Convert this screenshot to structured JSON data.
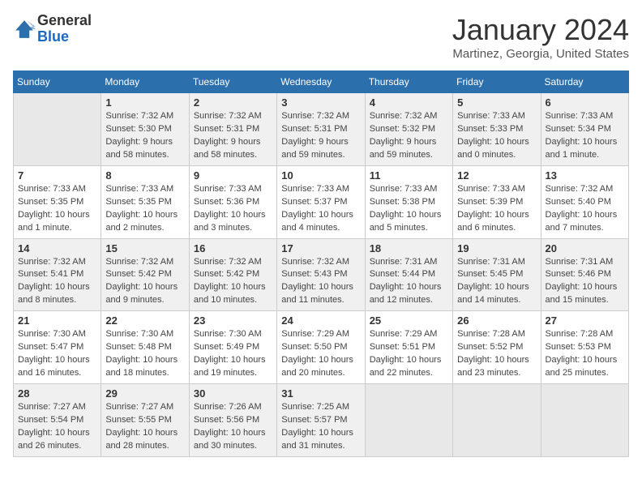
{
  "logo": {
    "general": "General",
    "blue": "Blue"
  },
  "title": "January 2024",
  "location": "Martinez, Georgia, United States",
  "days_header": [
    "Sunday",
    "Monday",
    "Tuesday",
    "Wednesday",
    "Thursday",
    "Friday",
    "Saturday"
  ],
  "weeks": [
    [
      {
        "num": "",
        "info": ""
      },
      {
        "num": "1",
        "info": "Sunrise: 7:32 AM\nSunset: 5:30 PM\nDaylight: 9 hours\nand 58 minutes."
      },
      {
        "num": "2",
        "info": "Sunrise: 7:32 AM\nSunset: 5:31 PM\nDaylight: 9 hours\nand 58 minutes."
      },
      {
        "num": "3",
        "info": "Sunrise: 7:32 AM\nSunset: 5:31 PM\nDaylight: 9 hours\nand 59 minutes."
      },
      {
        "num": "4",
        "info": "Sunrise: 7:32 AM\nSunset: 5:32 PM\nDaylight: 9 hours\nand 59 minutes."
      },
      {
        "num": "5",
        "info": "Sunrise: 7:33 AM\nSunset: 5:33 PM\nDaylight: 10 hours\nand 0 minutes."
      },
      {
        "num": "6",
        "info": "Sunrise: 7:33 AM\nSunset: 5:34 PM\nDaylight: 10 hours\nand 1 minute."
      }
    ],
    [
      {
        "num": "7",
        "info": "Sunrise: 7:33 AM\nSunset: 5:35 PM\nDaylight: 10 hours\nand 1 minute."
      },
      {
        "num": "8",
        "info": "Sunrise: 7:33 AM\nSunset: 5:35 PM\nDaylight: 10 hours\nand 2 minutes."
      },
      {
        "num": "9",
        "info": "Sunrise: 7:33 AM\nSunset: 5:36 PM\nDaylight: 10 hours\nand 3 minutes."
      },
      {
        "num": "10",
        "info": "Sunrise: 7:33 AM\nSunset: 5:37 PM\nDaylight: 10 hours\nand 4 minutes."
      },
      {
        "num": "11",
        "info": "Sunrise: 7:33 AM\nSunset: 5:38 PM\nDaylight: 10 hours\nand 5 minutes."
      },
      {
        "num": "12",
        "info": "Sunrise: 7:33 AM\nSunset: 5:39 PM\nDaylight: 10 hours\nand 6 minutes."
      },
      {
        "num": "13",
        "info": "Sunrise: 7:32 AM\nSunset: 5:40 PM\nDaylight: 10 hours\nand 7 minutes."
      }
    ],
    [
      {
        "num": "14",
        "info": "Sunrise: 7:32 AM\nSunset: 5:41 PM\nDaylight: 10 hours\nand 8 minutes."
      },
      {
        "num": "15",
        "info": "Sunrise: 7:32 AM\nSunset: 5:42 PM\nDaylight: 10 hours\nand 9 minutes."
      },
      {
        "num": "16",
        "info": "Sunrise: 7:32 AM\nSunset: 5:42 PM\nDaylight: 10 hours\nand 10 minutes."
      },
      {
        "num": "17",
        "info": "Sunrise: 7:32 AM\nSunset: 5:43 PM\nDaylight: 10 hours\nand 11 minutes."
      },
      {
        "num": "18",
        "info": "Sunrise: 7:31 AM\nSunset: 5:44 PM\nDaylight: 10 hours\nand 12 minutes."
      },
      {
        "num": "19",
        "info": "Sunrise: 7:31 AM\nSunset: 5:45 PM\nDaylight: 10 hours\nand 14 minutes."
      },
      {
        "num": "20",
        "info": "Sunrise: 7:31 AM\nSunset: 5:46 PM\nDaylight: 10 hours\nand 15 minutes."
      }
    ],
    [
      {
        "num": "21",
        "info": "Sunrise: 7:30 AM\nSunset: 5:47 PM\nDaylight: 10 hours\nand 16 minutes."
      },
      {
        "num": "22",
        "info": "Sunrise: 7:30 AM\nSunset: 5:48 PM\nDaylight: 10 hours\nand 18 minutes."
      },
      {
        "num": "23",
        "info": "Sunrise: 7:30 AM\nSunset: 5:49 PM\nDaylight: 10 hours\nand 19 minutes."
      },
      {
        "num": "24",
        "info": "Sunrise: 7:29 AM\nSunset: 5:50 PM\nDaylight: 10 hours\nand 20 minutes."
      },
      {
        "num": "25",
        "info": "Sunrise: 7:29 AM\nSunset: 5:51 PM\nDaylight: 10 hours\nand 22 minutes."
      },
      {
        "num": "26",
        "info": "Sunrise: 7:28 AM\nSunset: 5:52 PM\nDaylight: 10 hours\nand 23 minutes."
      },
      {
        "num": "27",
        "info": "Sunrise: 7:28 AM\nSunset: 5:53 PM\nDaylight: 10 hours\nand 25 minutes."
      }
    ],
    [
      {
        "num": "28",
        "info": "Sunrise: 7:27 AM\nSunset: 5:54 PM\nDaylight: 10 hours\nand 26 minutes."
      },
      {
        "num": "29",
        "info": "Sunrise: 7:27 AM\nSunset: 5:55 PM\nDaylight: 10 hours\nand 28 minutes."
      },
      {
        "num": "30",
        "info": "Sunrise: 7:26 AM\nSunset: 5:56 PM\nDaylight: 10 hours\nand 30 minutes."
      },
      {
        "num": "31",
        "info": "Sunrise: 7:25 AM\nSunset: 5:57 PM\nDaylight: 10 hours\nand 31 minutes."
      },
      {
        "num": "",
        "info": ""
      },
      {
        "num": "",
        "info": ""
      },
      {
        "num": "",
        "info": ""
      }
    ]
  ]
}
